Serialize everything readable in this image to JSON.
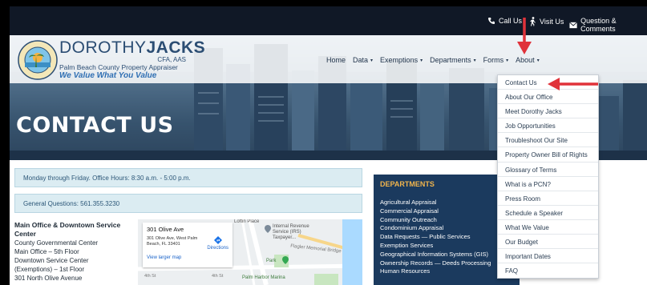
{
  "utility_bar": {
    "call_label": "Call Us",
    "visit_label": "Visit Us",
    "question_label": "Question & Comments"
  },
  "brand": {
    "name_light": "DOROTHY",
    "name_bold": "JACKS",
    "credentials": "CFA, AAS",
    "subtitle": "Palm Beach County Property Appraiser",
    "tagline": "We Value What You Value",
    "seal_text": "PALM BEACH COUNTY PROPERTY APPRAISER"
  },
  "main_nav": [
    {
      "label": "Home",
      "has_caret": false
    },
    {
      "label": "Data",
      "has_caret": true
    },
    {
      "label": "Exemptions",
      "has_caret": true
    },
    {
      "label": "Departments",
      "has_caret": true
    },
    {
      "label": "Forms",
      "has_caret": true
    },
    {
      "label": "About",
      "has_caret": true
    }
  ],
  "caret_glyph": "▾",
  "hero": {
    "title": "CONTACT US"
  },
  "info": {
    "hours": "Monday through Friday. Office Hours: 8:30 a.m. - 5:00 p.m.",
    "questions": "General Questions: 561.355.3230"
  },
  "main_office": {
    "heading_line1": "Main Office & Downtown Service",
    "heading_line2": "Center",
    "lines": [
      "County Governmental Center",
      "Main Office – 5th Floor",
      "Downtown Service Center",
      "(Exemptions) – 1st Floor",
      "301 North Olive Avenue"
    ]
  },
  "map": {
    "card_title": "301 Olive Ave",
    "card_address": "301 Olive Ave, West Palm Beach, FL 33401",
    "directions_label": "Directions",
    "view_larger": "View larger map",
    "labels": {
      "place": "Loftin Place",
      "irs": "Internal Revenue Service (IRS) Taxpayer...",
      "bridge": "Flagler Memorial Bridge",
      "park": "Park",
      "marina": "Palm Harbor Marina",
      "street1": "4th St",
      "street2": "4th St"
    }
  },
  "departments": {
    "title": "DEPARTMENTS",
    "items": [
      "Agricultural Appraisal",
      "Commercial Appraisal",
      "Community Outreach",
      "Condominium Appraisal",
      "Data Requests — Public Services",
      "Exemption Services",
      "Geographical Information Systems (GIS)",
      "Ownership Records — Deeds Processing",
      "Human Resources"
    ]
  },
  "about_dropdown": [
    "Contact Us",
    "About Our Office",
    "Meet Dorothy Jacks",
    "Job Opportunities",
    "Troubleshoot Our Site",
    "Property Owner Bill of Rights",
    "Glossary of Terms",
    "What is a PCN?",
    "Press Room",
    "Schedule a Speaker",
    "What We Value",
    "Our Budget",
    "Important Dates",
    "FAQ"
  ],
  "colors": {
    "annotation_arrow": "#e0323a",
    "topbar": "#101826",
    "departments_bg": "#1b3a5e",
    "departments_title": "#f0b44c",
    "info_box": "#dbecf2"
  }
}
